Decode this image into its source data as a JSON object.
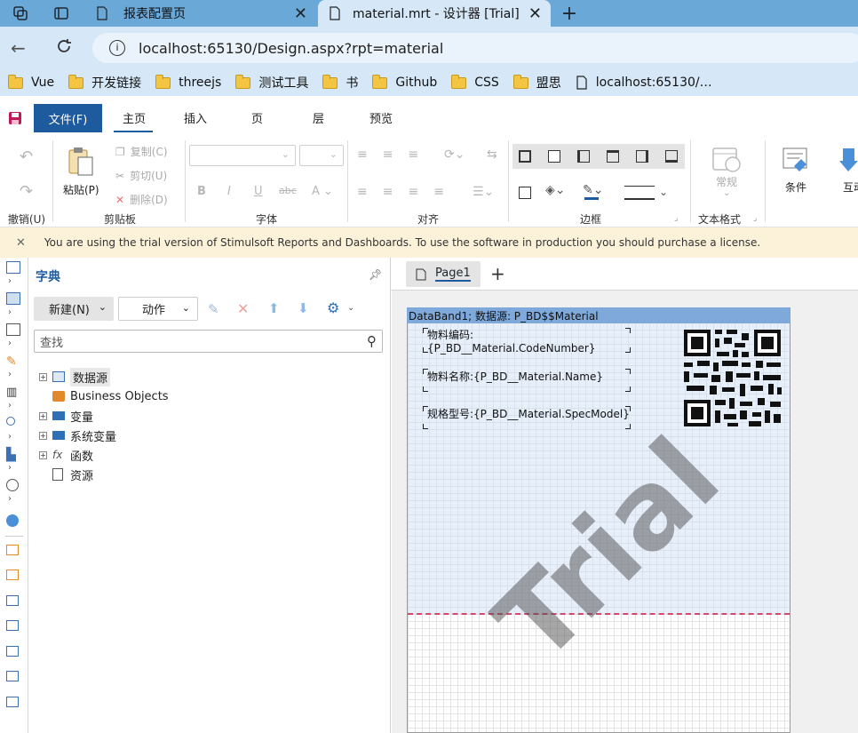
{
  "browser": {
    "tabs": [
      {
        "label": "报表配置页"
      },
      {
        "label": "material.mrt - 设计器 [Trial]"
      }
    ],
    "url": "localhost:65130/Design.aspx?rpt=material",
    "bookmarks": [
      "Vue",
      "开发链接",
      "threejs",
      "测试工具",
      "书",
      "Github",
      "CSS",
      "盟思",
      "localhost:65130/…"
    ]
  },
  "ribbon": {
    "tabs": {
      "file": "文件(F)",
      "home": "主页",
      "insert": "插入",
      "page": "页",
      "layer": "层",
      "preview": "预览"
    },
    "paste": "粘贴(P)",
    "copy": "复制(C)",
    "cut": "剪切(U)",
    "delete": "删除(D)",
    "groups": {
      "undo": "撤销(U)",
      "clipboard": "剪贴板",
      "font": "字体",
      "align": "对齐",
      "border": "边框",
      "textformat": "文本格式"
    },
    "format_general": "常规",
    "condition": "条件",
    "interaction": "互动"
  },
  "trial_notice": "You are using the trial version of Stimulsoft Reports and Dashboards. To use the software in production you should purchase a license.",
  "dictionary": {
    "title": "字典",
    "new_button": "新建(N)",
    "action_button": "动作",
    "search_placeholder": "查找",
    "tree": [
      "数据源",
      "Business Objects",
      "变量",
      "系统变量",
      "函数",
      "资源"
    ]
  },
  "designer": {
    "page_tab": "Page1",
    "band_header": "DataBand1; 数据源: P_BD$$Material",
    "fields": [
      "物料编码:{P_BD__Material.CodeNumber}",
      "物料名称:{P_BD__Material.Name}",
      "规格型号:{P_BD__Material.SpecModel}"
    ],
    "watermark": "Trial"
  }
}
